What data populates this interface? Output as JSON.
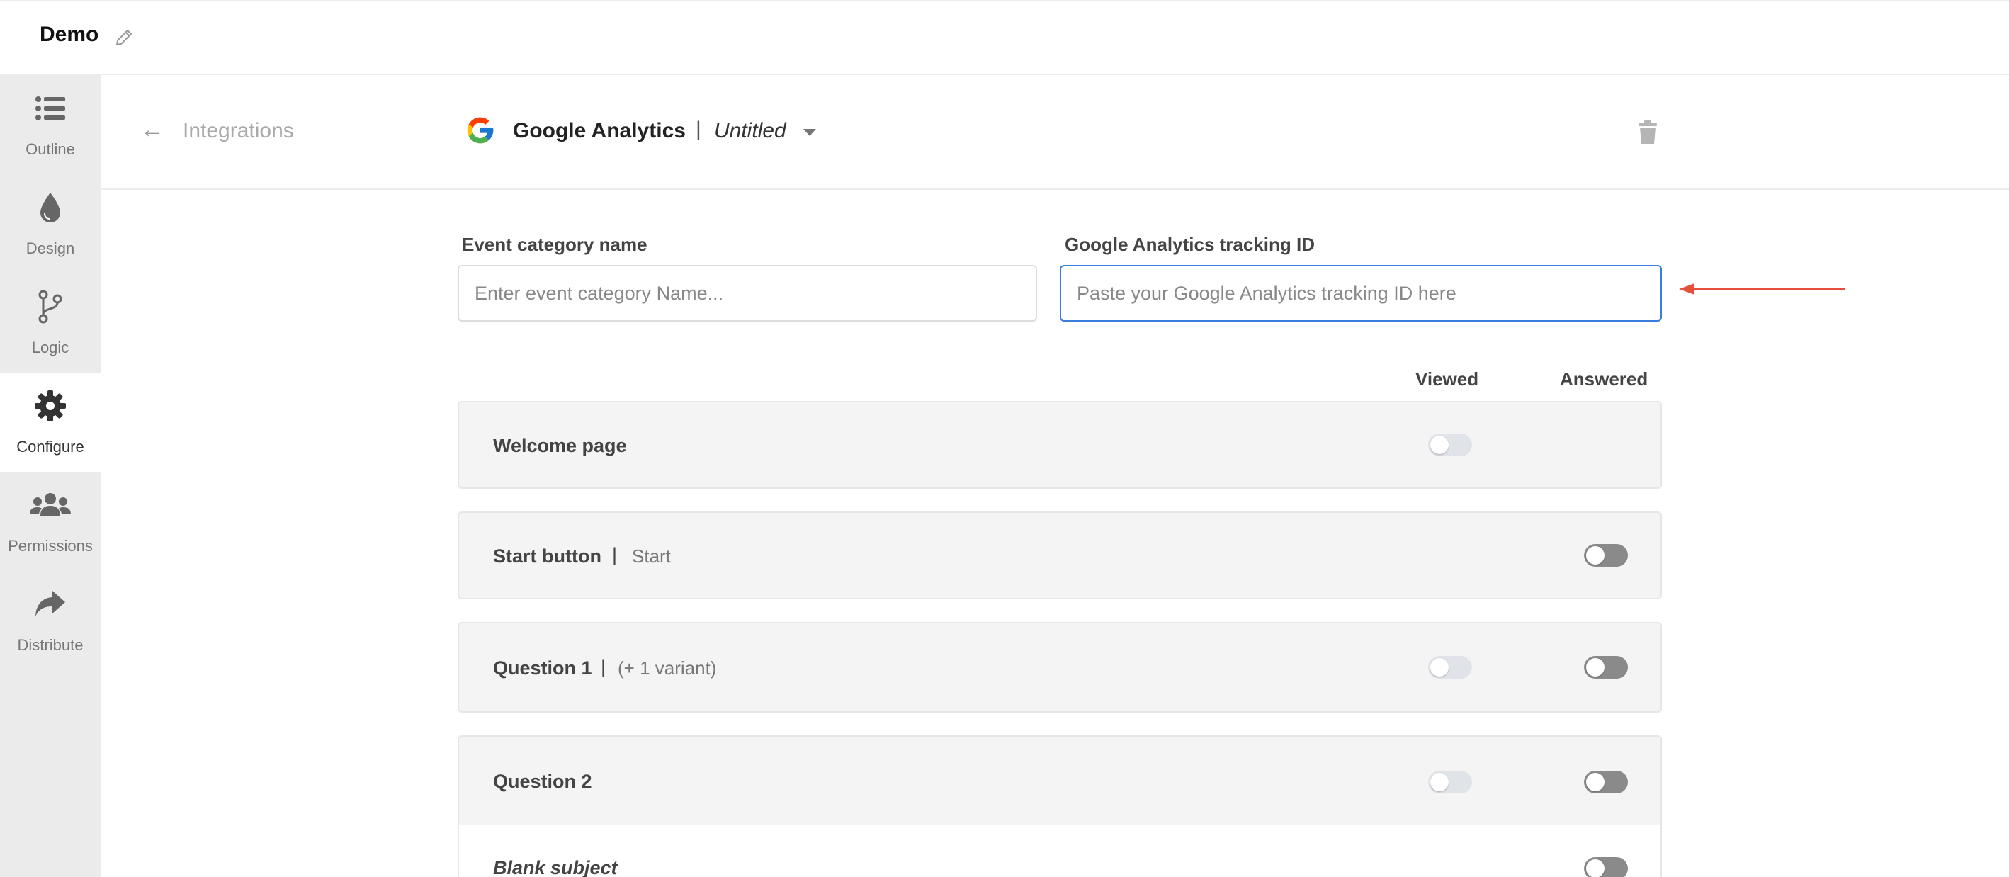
{
  "app": {
    "title": "Demo"
  },
  "sidebar": {
    "items": [
      {
        "label": "Outline",
        "icon": "list-icon",
        "active": false
      },
      {
        "label": "Design",
        "icon": "droplet-icon",
        "active": false
      },
      {
        "label": "Logic",
        "icon": "branch-icon",
        "active": false
      },
      {
        "label": "Configure",
        "icon": "gear-icon",
        "active": true
      },
      {
        "label": "Permissions",
        "icon": "users-icon",
        "active": false
      },
      {
        "label": "Distribute",
        "icon": "share-icon",
        "active": false
      }
    ]
  },
  "header": {
    "back_label": "Integrations",
    "integration_name": "Google Analytics",
    "separator": "|",
    "instance_name": "Untitled"
  },
  "form": {
    "event_category": {
      "label": "Event category name",
      "placeholder": "Enter event category Name..."
    },
    "tracking_id": {
      "label": "Google Analytics tracking ID",
      "placeholder": "Paste your Google Analytics tracking ID here"
    }
  },
  "columns": {
    "viewed": "Viewed",
    "answered": "Answered"
  },
  "rows": [
    {
      "title": "Welcome page",
      "separator": "",
      "subtitle": "",
      "viewed": false,
      "answered": null
    },
    {
      "title": "Start button",
      "separator": "|",
      "subtitle": "Start",
      "viewed": null,
      "answered": false
    },
    {
      "title": "Question 1",
      "separator": "|",
      "subtitle": "(+ 1 variant)",
      "viewed": false,
      "answered": false
    },
    {
      "title": "Question 2",
      "separator": "",
      "subtitle": "",
      "viewed": false,
      "answered": false
    },
    {
      "title": "Blank subject",
      "separator": "",
      "subtitle": "",
      "viewed": null,
      "answered": false
    }
  ],
  "colors": {
    "sidebar_bg": "#ebebeb",
    "focus_border": "#3b7ddd",
    "annotation_arrow": "#e5503a",
    "toggle_off_light": "#e0e3e8",
    "toggle_off_dark": "#8a8a8a"
  }
}
